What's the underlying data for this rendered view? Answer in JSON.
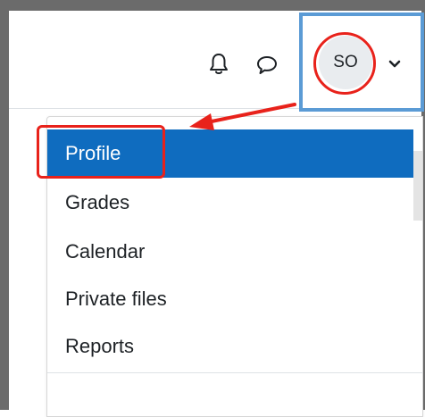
{
  "user": {
    "initials": "SO"
  },
  "icons": {
    "notifications": "bell-icon",
    "messages": "chat-bubble-icon",
    "menu_toggle": "chevron-down-icon"
  },
  "user_menu": {
    "items": [
      {
        "label": "Profile",
        "active": true
      },
      {
        "label": "Grades",
        "active": false
      },
      {
        "label": "Calendar",
        "active": false
      },
      {
        "label": "Private files",
        "active": false
      },
      {
        "label": "Reports",
        "active": false
      }
    ]
  },
  "colors": {
    "active_item": "#0f6cbf",
    "annotation_red": "#e8221b",
    "annotation_blue": "#5b9bd5"
  }
}
